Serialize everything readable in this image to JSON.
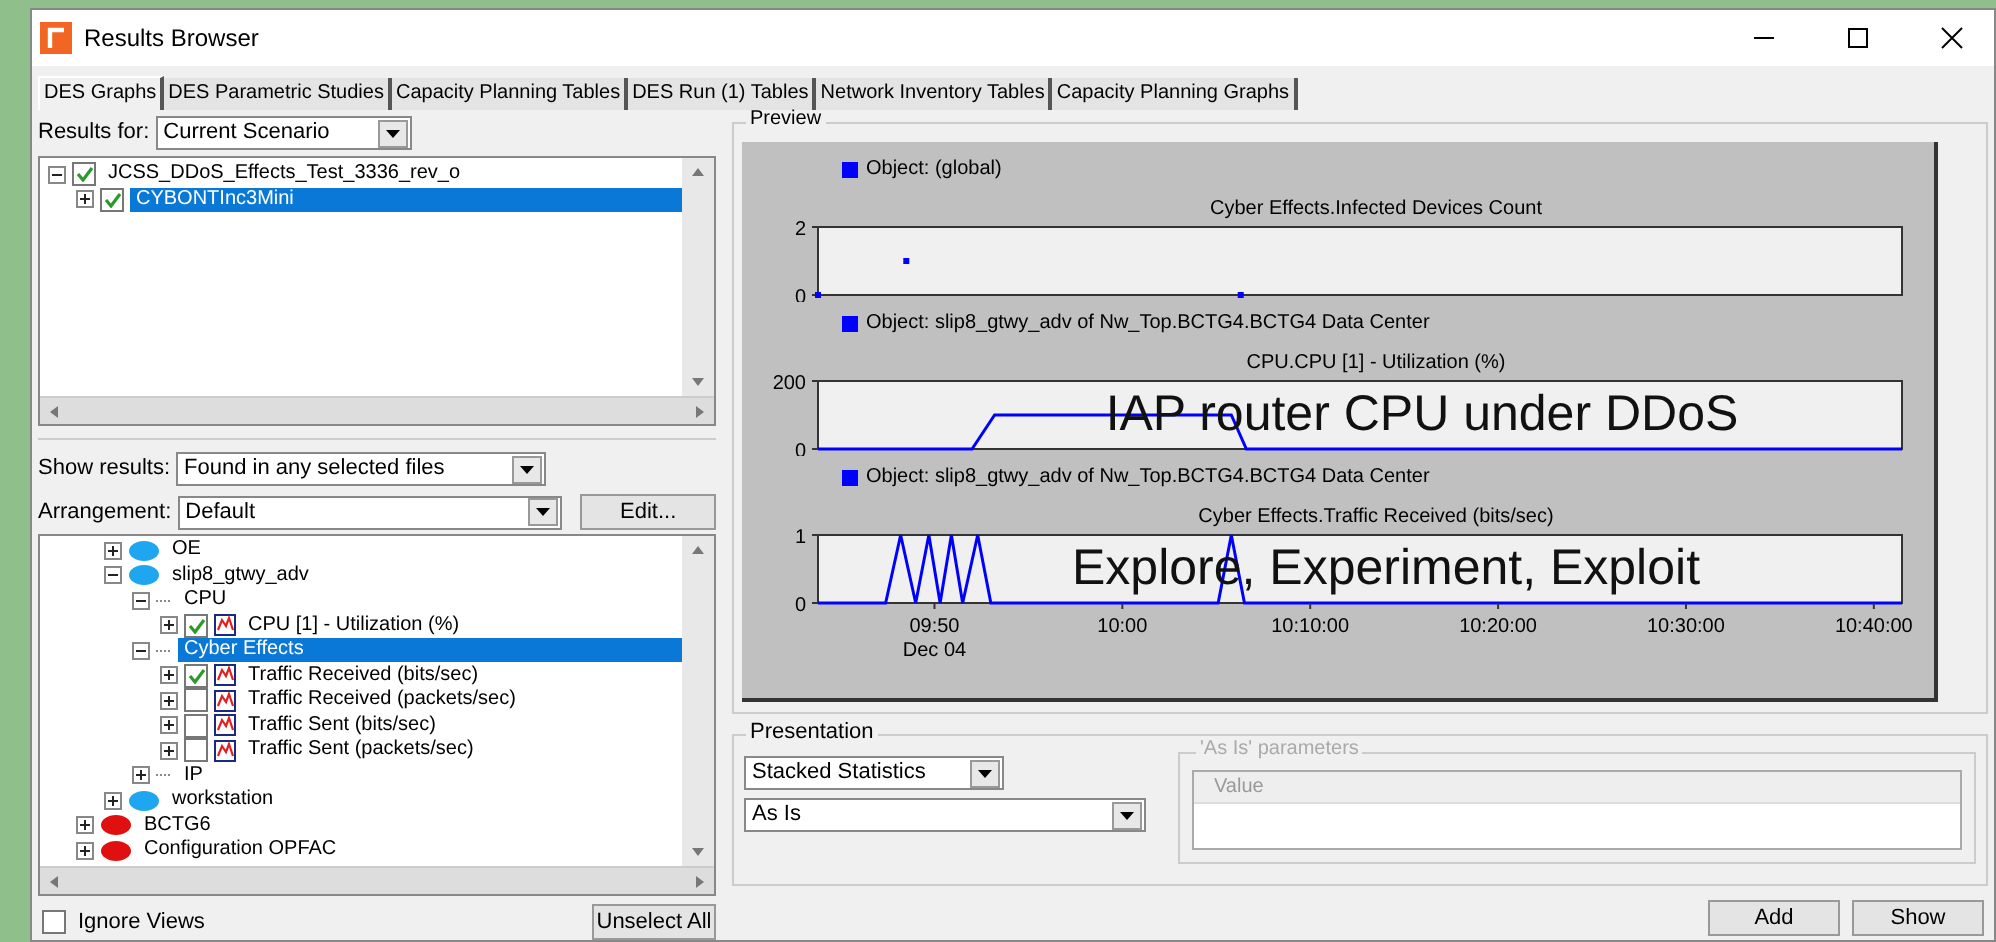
{
  "window": {
    "title": "Results Browser"
  },
  "tabs": [
    {
      "label": "DES Graphs",
      "selected": true
    },
    {
      "label": "DES Parametric Studies",
      "selected": false
    },
    {
      "label": "Capacity Planning Tables",
      "selected": false
    },
    {
      "label": "DES Run (1) Tables",
      "selected": false
    },
    {
      "label": "Network Inventory Tables",
      "selected": false
    },
    {
      "label": "Capacity Planning Graphs",
      "selected": false
    }
  ],
  "results_for": {
    "label": "Results for:",
    "value": "Current Scenario"
  },
  "file_tree": [
    {
      "kind": "file",
      "label": "JCSS_DDoS_Effects_Test_3336_rev_o",
      "checked": true,
      "expanded": true,
      "selected": false,
      "children": [
        {
          "kind": "file",
          "label": "CYBONTInc3Mini",
          "checked": true,
          "expanded": false,
          "selected": true
        }
      ]
    }
  ],
  "show_results": {
    "label": "Show results:",
    "value": "Found in any selected files"
  },
  "arrangement": {
    "label": "Arrangement:",
    "value": "Default",
    "button": "Edit..."
  },
  "stat_tree": [
    {
      "children": [
        {
          "kind": "node",
          "label": "OE",
          "color": "#1ea7f0",
          "expanded": false,
          "selected": false
        },
        {
          "kind": "node",
          "label": "slip8_gtwy_adv",
          "color": "#1ea7f0",
          "expanded": true,
          "selected": false,
          "children": [
            {
              "kind": "group",
              "label": "CPU",
              "expanded": true,
              "selected": false,
              "children": [
                {
                  "kind": "statistic",
                  "label": "CPU [1] - Utilization (%)",
                  "checked": true,
                  "expanded": false,
                  "selected": false
                }
              ]
            },
            {
              "kind": "group",
              "label": "Cyber Effects",
              "expanded": true,
              "selected": true,
              "children": [
                {
                  "kind": "statistic",
                  "label": "Traffic Received (bits/sec)",
                  "checked": true,
                  "expanded": false,
                  "selected": false
                },
                {
                  "kind": "statistic",
                  "label": "Traffic Received (packets/sec)",
                  "checked": false,
                  "expanded": false,
                  "selected": false
                },
                {
                  "kind": "statistic",
                  "label": "Traffic Sent (bits/sec)",
                  "checked": false,
                  "expanded": false,
                  "selected": false
                },
                {
                  "kind": "statistic",
                  "label": "Traffic Sent (packets/sec)",
                  "checked": false,
                  "expanded": false,
                  "selected": false
                }
              ]
            },
            {
              "kind": "group",
              "label": "IP",
              "expanded": false,
              "selected": false
            }
          ]
        },
        {
          "kind": "node",
          "label": "workstation",
          "color": "#1ea7f0",
          "expanded": false,
          "selected": false
        }
      ]
    },
    {
      "kind": "node",
      "label": "BCTG6",
      "color": "#e01010",
      "expanded": false,
      "selected": false
    },
    {
      "kind": "node",
      "label": "Configuration OPFAC",
      "color": "#e01010",
      "expanded": false,
      "selected": false
    }
  ],
  "ignore_views": {
    "label": "Ignore Views",
    "checked": false
  },
  "unselect_button": "Unselect All",
  "preview": {
    "title": "Preview",
    "charts": [
      {
        "chart_data": {
          "type": "scatter",
          "title": "Cyber Effects.Infected Devices Count",
          "x": [
            35028,
            35310,
            36378
          ],
          "xlim": [
            35028,
            38490
          ],
          "ylim": [
            0,
            2
          ],
          "yticks": [
            0,
            2
          ],
          "series": [
            {
              "name": "Object: (global)",
              "color": "#0000ff",
              "values": [
                0,
                1,
                0
              ]
            }
          ]
        }
      },
      {
        "caption": "IAP router CPU under DDoS",
        "chart_data": {
          "type": "line",
          "title": "CPU.CPU [1] - Utilization (%)",
          "x": [
            35028,
            35520,
            35592,
            36348,
            36396,
            38490
          ],
          "xlim": [
            35028,
            38490
          ],
          "ylim": [
            0,
            200
          ],
          "yticks": [
            0,
            200
          ],
          "series": [
            {
              "name": "Object: slip8_gtwy_adv of Nw_Top.BCTG4.BCTG4 Data Center",
              "color": "#0000ff",
              "values": [
                0,
                0,
                100,
                100,
                0,
                0
              ]
            }
          ]
        }
      },
      {
        "caption": "Explore, Experiment, Exploit",
        "date_label": "Dec 04",
        "chart_data": {
          "type": "line",
          "title": "Cyber Effects.Traffic Received (bits/sec)",
          "x": [
            35028,
            35244,
            35292,
            35340,
            35382,
            35418,
            35454,
            35490,
            35538,
            35580,
            36306,
            36348,
            36390,
            38490
          ],
          "xlim": [
            35028,
            38490
          ],
          "ylim": [
            0,
            1
          ],
          "yticks": [
            0,
            1
          ],
          "xticks": [
            {
              "value": 35400,
              "label": "09:50"
            },
            {
              "value": 36000,
              "label": "10:00"
            },
            {
              "value": 36600,
              "label": "10:10:00"
            },
            {
              "value": 37200,
              "label": "10:20:00"
            },
            {
              "value": 37800,
              "label": "10:30:00"
            },
            {
              "value": 38400,
              "label": "10:40:00"
            }
          ],
          "series": [
            {
              "name": "Object: slip8_gtwy_adv of Nw_Top.BCTG4.BCTG4 Data Center",
              "color": "#0000ff",
              "values": [
                0,
                0,
                1,
                0,
                1,
                0,
                1,
                0,
                1,
                0,
                0,
                1,
                0,
                0
              ]
            }
          ]
        }
      }
    ]
  },
  "presentation": {
    "title": "Presentation",
    "type": "Stacked Statistics",
    "mode": "As Is",
    "parameters": {
      "title": "'As Is' parameters",
      "column": "Value"
    }
  },
  "buttons": [
    "Add",
    "Show"
  ]
}
